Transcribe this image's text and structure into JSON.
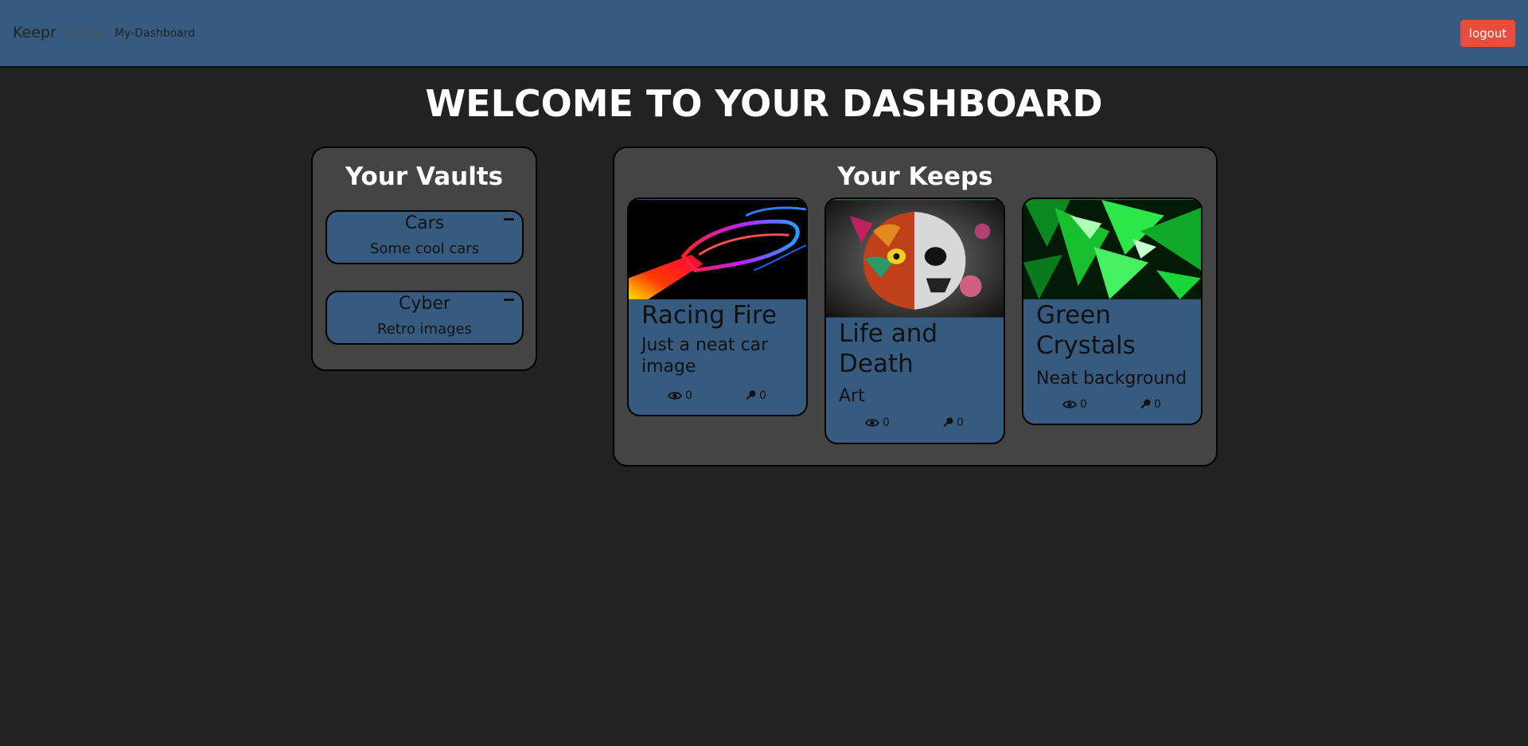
{
  "navbar": {
    "brand": "Keepr",
    "links": [
      "Home",
      "My-Dashboard"
    ],
    "logout_label": "logout"
  },
  "page_title": "WELCOME TO YOUR DASHBOARD",
  "vaults": {
    "title": "Your Vaults",
    "items": [
      {
        "name": "Cars",
        "description": "Some cool cars"
      },
      {
        "name": "Cyber",
        "description": "Retro images"
      }
    ]
  },
  "keeps": {
    "title": "Your Keeps",
    "items": [
      {
        "title": "Racing Fire",
        "description": "Just a neat car image",
        "views": "0",
        "keeps": "0"
      },
      {
        "title": "Life and Death",
        "description": "Art",
        "views": "0",
        "keeps": "0"
      },
      {
        "title": "Green Crystals",
        "description": "Neat background",
        "views": "0",
        "keeps": "0"
      }
    ]
  },
  "icons": {
    "views": "eye-icon",
    "keeps": "key-icon",
    "remove": "minus-icon"
  },
  "colors": {
    "navbar": "#375a7f",
    "background": "#222222",
    "panel": "#444444",
    "logout": "#e74c3c"
  }
}
